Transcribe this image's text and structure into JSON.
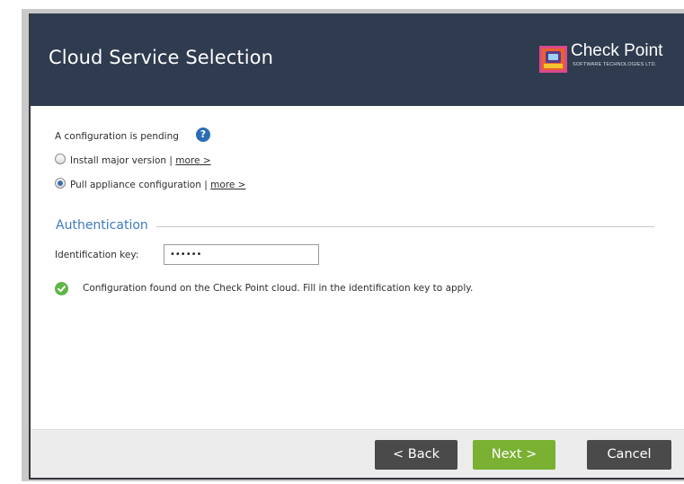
{
  "window": {
    "title": "Cloud Service Selection"
  },
  "brand": {
    "name": "Check Point",
    "tagline": "SOFTWARE TECHNOLOGIES LTD."
  },
  "status": {
    "pending_text": "A configuration is pending",
    "help_glyph": "?",
    "help_icon": "help-icon"
  },
  "options": [
    {
      "label": "Install major version | ",
      "link": "more >",
      "selected": false
    },
    {
      "label": "Pull appliance configuration | ",
      "link": "more >",
      "selected": true
    }
  ],
  "auth": {
    "section_title": "Authentication",
    "id_key_label": "Identification key:",
    "id_key_value": "••••••",
    "status_message": "Configuration found on the Check Point cloud. Fill in the identification key to apply.",
    "status_icon": "check-circle-icon"
  },
  "buttons": {
    "back": "< Back",
    "next": "Next >",
    "cancel": "Cancel"
  },
  "colors": {
    "header_bg": "#2f3b4f",
    "accent_blue": "#3d7abf",
    "next_green": "#7ab133",
    "button_dark": "#4a4a4a",
    "success_green": "#5fb548"
  }
}
